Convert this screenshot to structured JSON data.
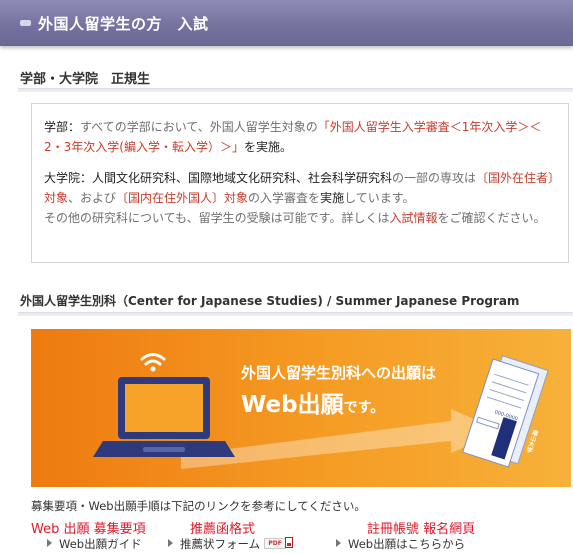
{
  "header": {
    "title": "外国人留学生の方　入試"
  },
  "section1": {
    "heading": "学部・大学院　正規生",
    "undergrad": {
      "label": "学部：",
      "text1": "すべての学部において、外国人留学生対象の",
      "link": "「外国人留学生入学審査＜1年次入学＞＜2・3年次入学(編入学・転入学）＞」",
      "text2": "を実施。"
    },
    "grad": {
      "label": "大学院：",
      "schools": "人間文化研究科、国際地域文化研究科、社会科学研究科",
      "text1": "の一部の専攻は",
      "link1": "〔国外在住者〕対象",
      "text2": "、および",
      "link2": "〔国内在住外国人〕対象",
      "text3": "の入学審査を",
      "text4": "実施",
      "text5": "しています。"
    },
    "other": {
      "text1": "その他の研究科についても、留学生の受験は可能です。詳しくは",
      "link": "入試情報",
      "text2": "をご確認ください。"
    }
  },
  "section2": {
    "heading": "外国人留学生別科（Center for Japanese Studies) / Summer Japanese Program",
    "banner": {
      "line1": "外国人留学生別科への出願は",
      "line2_main": "Web出願",
      "line2_suffix": "です。",
      "envelope_text": "南山大学",
      "envelope_code": "000-0000"
    },
    "note": "募集要項・Web出願手順は下記のリンクを参考にしてください。",
    "annotations": [
      "Web 出願 募集要項",
      "推薦函格式",
      "註冊帳號 報名網頁"
    ],
    "links": [
      "Web出願ガイド",
      "推薦状フォーム",
      "Web出願はこちらから"
    ],
    "pdf_label": "PDF"
  },
  "colors": {
    "header_bar": "#76729f",
    "link_red": "#c63d2f",
    "banner_orange": "#f08a18",
    "annotation_red": "#e0192a"
  }
}
